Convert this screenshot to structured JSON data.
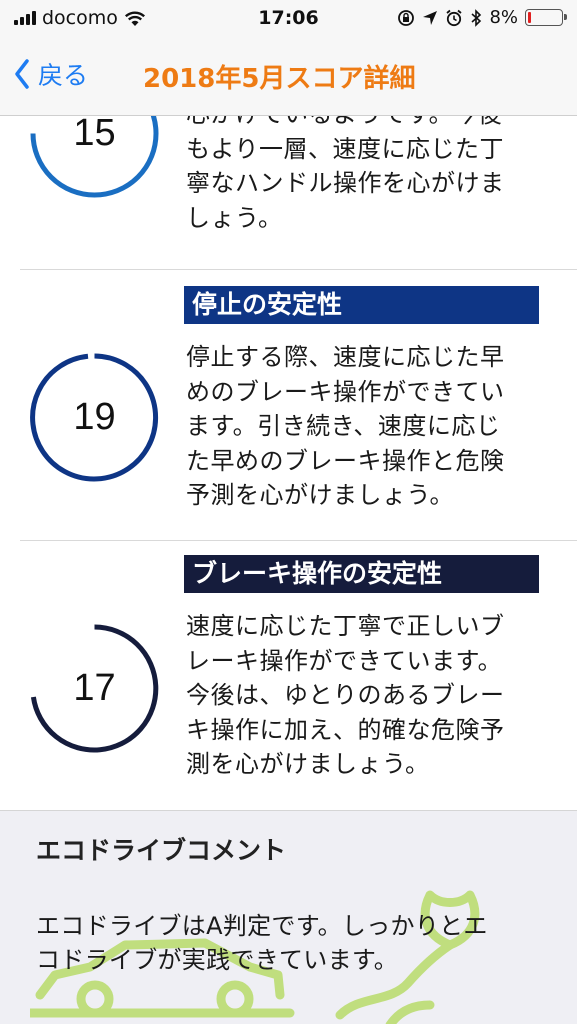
{
  "status_bar": {
    "carrier": "docomo",
    "time": "17:06",
    "battery_percent": "8%"
  },
  "nav": {
    "back_label": "戻る",
    "title": "2018年5月スコア詳細"
  },
  "items": [
    {
      "score": "15",
      "ring_color": "#1a6ec2",
      "lines": [
        "心がけているようです。今後",
        "もより一層、速度に応じた丁",
        "寧なハンドル操作を心がけま",
        "しょう。"
      ]
    },
    {
      "heading": "停止の安定性",
      "heading_color": "#0e3585",
      "score": "19",
      "ring_color": "#0e3585",
      "lines": [
        "停止する際、速度に応じた早",
        "めのブレーキ操作ができてい",
        "ます。引き続き、速度に応じ",
        "た早めのブレーキ操作と危険",
        "予測を心がけましょう。"
      ]
    },
    {
      "heading": "ブレーキ操作の安定性",
      "heading_color": "#151c3c",
      "score": "17",
      "ring_color": "#151c3c",
      "lines": [
        "速度に応じた丁寧で正しいブ",
        "レーキ操作ができています。",
        "今後は、ゆとりのあるブレー",
        "キ操作に加え、的確な危険予",
        "測を心がけましょう。"
      ]
    }
  ],
  "eco": {
    "title": "エコドライブコメント",
    "lines": [
      "エコドライブはA判定です。しっかりとエ",
      "コドライブが実践できています。"
    ],
    "illustration_color": "#b8dc6a"
  }
}
